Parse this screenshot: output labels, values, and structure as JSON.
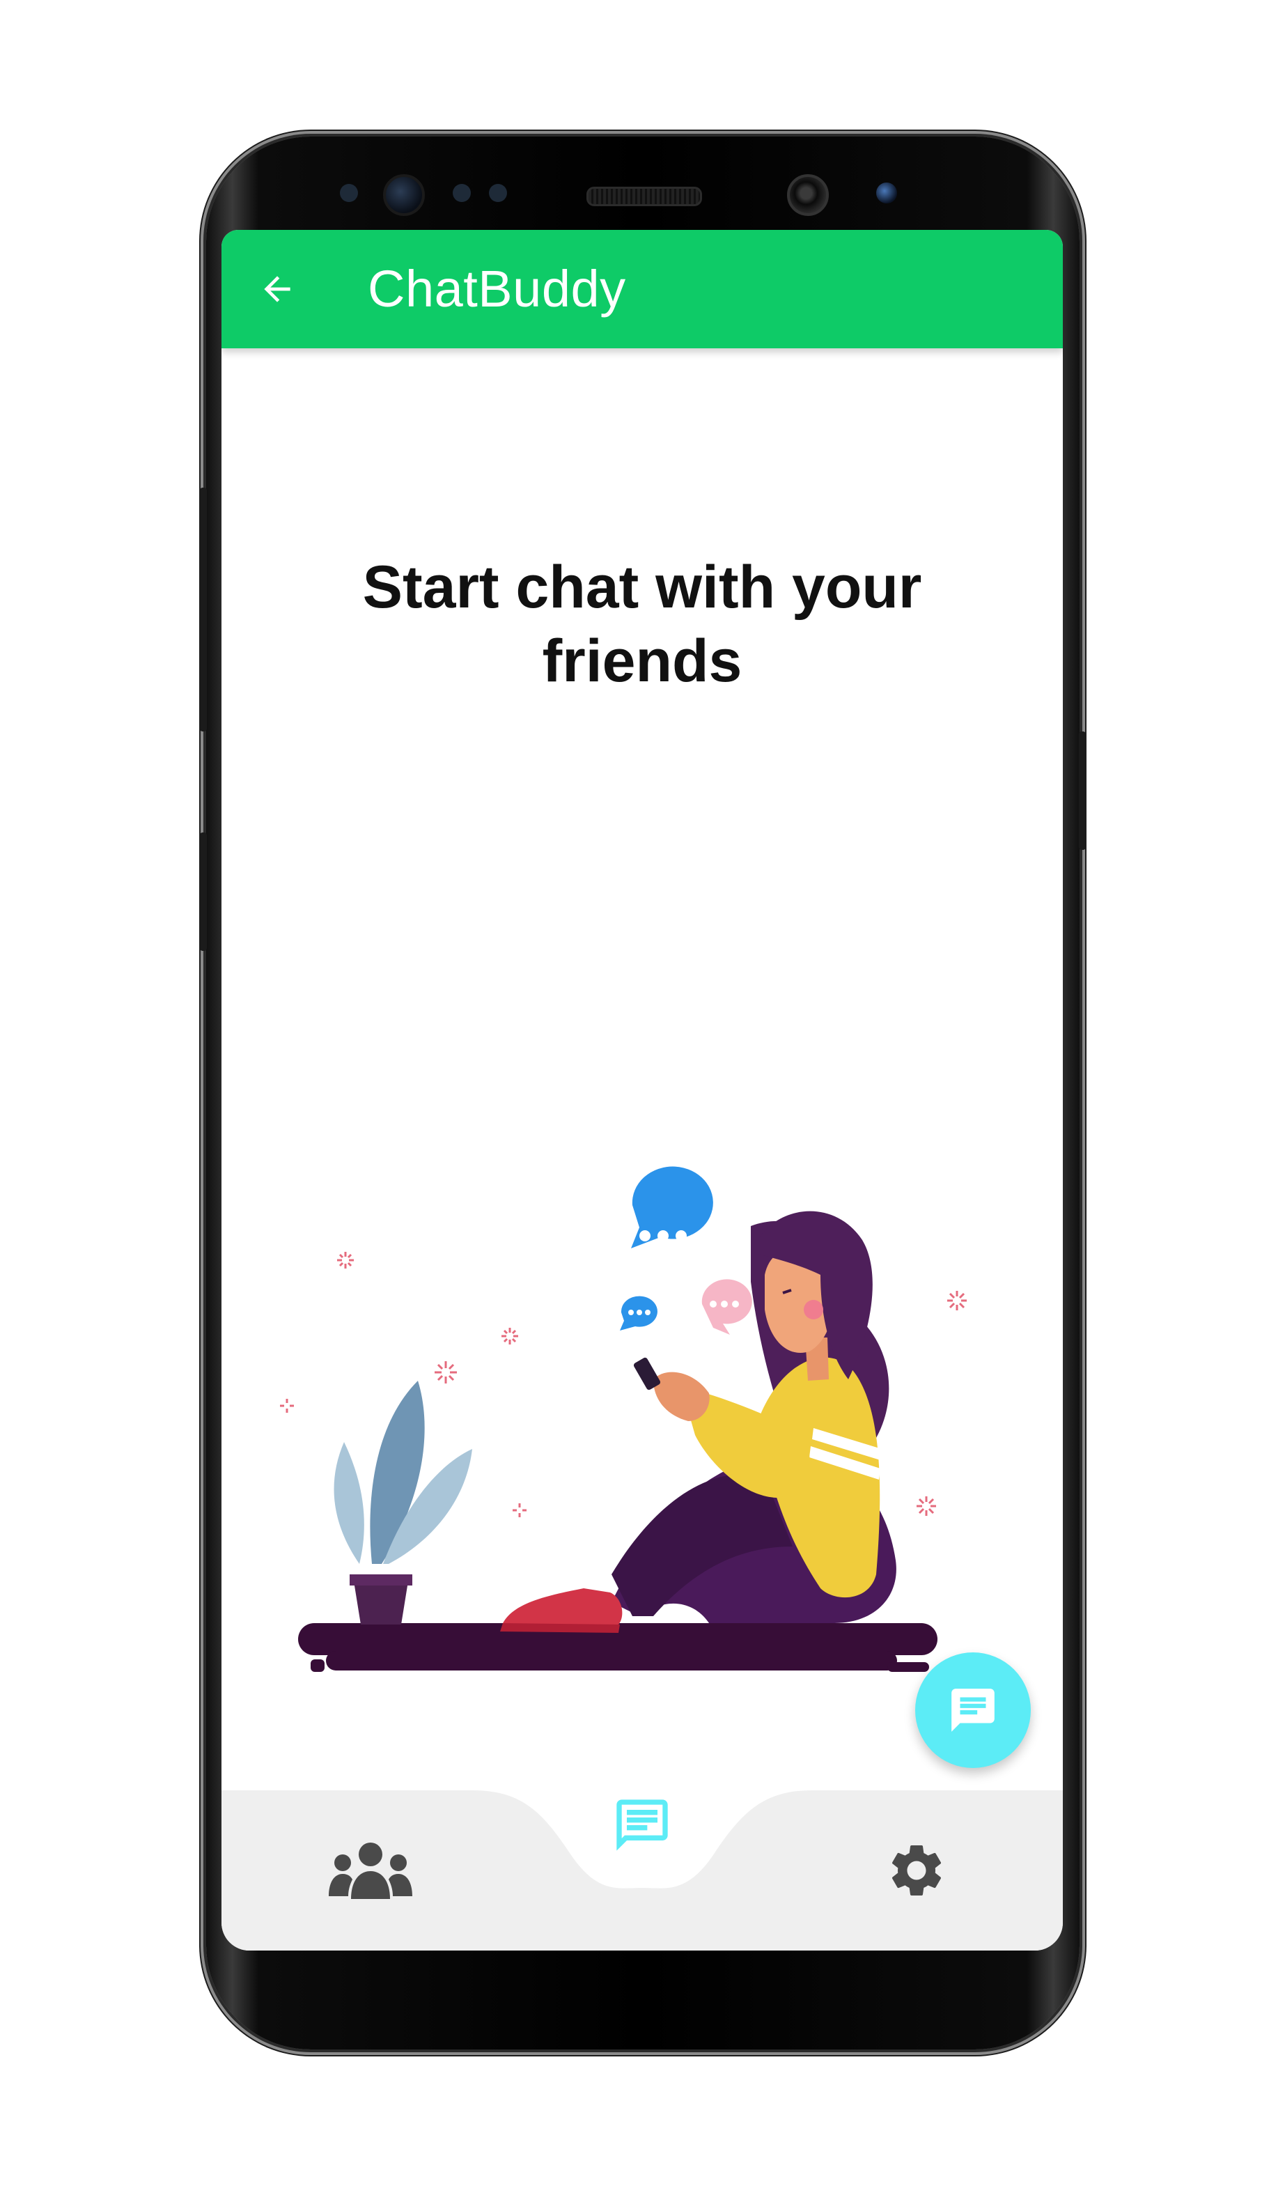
{
  "app": {
    "title": "ChatBuddy"
  },
  "main": {
    "heading_line1": "Start chat with your",
    "heading_line2": "friends"
  },
  "icons": {
    "back": "arrow-back-icon",
    "fab": "chat-icon",
    "nav_friends": "group-icon",
    "nav_chats": "chat-icon",
    "nav_settings": "gear-icon"
  },
  "bottom_nav": {
    "items": [
      "friends",
      "chats",
      "settings"
    ],
    "selected": "chats"
  },
  "colors": {
    "app_bar": "#0ecb67",
    "fab": "#5cecf6",
    "nav_active": "#5cecf6",
    "nav_inactive": "#4a4a4a",
    "nav_background": "#efefef"
  }
}
